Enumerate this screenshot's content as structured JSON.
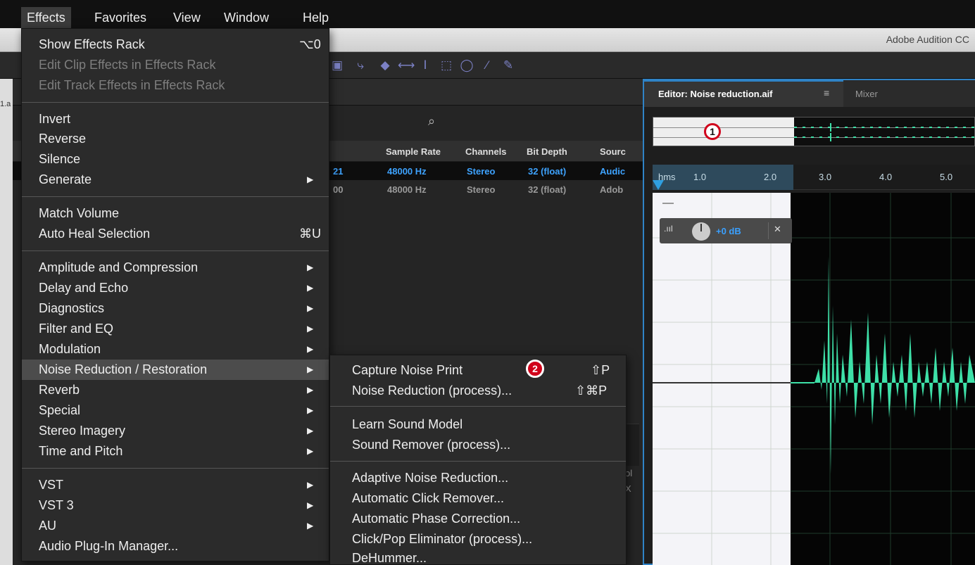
{
  "menubar": {
    "items": [
      {
        "label": "Effects"
      },
      {
        "label": "Favorites"
      },
      {
        "label": "View"
      },
      {
        "label": "Window"
      },
      {
        "label": "Help"
      }
    ]
  },
  "app": {
    "title": "Adobe Audition CC",
    "left_strip_text": "1.a"
  },
  "files_panel": {
    "columns": [
      "Sample Rate",
      "Channels",
      "Bit Depth",
      "Sourc"
    ],
    "rows": [
      {
        "prefix": "21",
        "sample_rate": "48000 Hz",
        "channels": "Stereo",
        "bit_depth": "32 (float)",
        "source": "Audic"
      },
      {
        "prefix": "00",
        "sample_rate": "48000 Hz",
        "channels": "Stereo",
        "bit_depth": "32 (float)",
        "source": "Adob"
      }
    ],
    "side_glyphs": [
      "ol",
      "X"
    ]
  },
  "editor": {
    "tab_label": "Editor: Noise reduction.aif",
    "tab_menu_icon": "≡",
    "mixer_label": "Mixer",
    "ruler": [
      "hms",
      "1.0",
      "2.0",
      "3.0",
      "4.0",
      "5.0"
    ],
    "hud_value": "+0 dB",
    "callout_1": "1",
    "waveform_color": "#3ee0a8"
  },
  "effects_menu": {
    "items": [
      {
        "label": "Show Effects Rack",
        "shortcut": "⌥0"
      },
      {
        "label": "Edit Clip Effects in Effects Rack",
        "disabled": true
      },
      {
        "label": "Edit Track Effects in Effects Rack",
        "disabled": true
      },
      {
        "label": "Invert"
      },
      {
        "label": "Reverse"
      },
      {
        "label": "Silence"
      },
      {
        "label": "Generate",
        "submenu": true
      },
      {
        "label": "Match Volume"
      },
      {
        "label": "Auto Heal Selection",
        "shortcut": "⌘U"
      },
      {
        "label": "Amplitude and Compression",
        "submenu": true
      },
      {
        "label": "Delay and Echo",
        "submenu": true
      },
      {
        "label": "Diagnostics",
        "submenu": true
      },
      {
        "label": "Filter and EQ",
        "submenu": true
      },
      {
        "label": "Modulation",
        "submenu": true
      },
      {
        "label": "Noise Reduction / Restoration",
        "submenu": true,
        "highlight": true
      },
      {
        "label": "Reverb",
        "submenu": true
      },
      {
        "label": "Special",
        "submenu": true
      },
      {
        "label": "Stereo Imagery",
        "submenu": true
      },
      {
        "label": "Time and Pitch",
        "submenu": true
      },
      {
        "label": "VST",
        "submenu": true
      },
      {
        "label": "VST 3",
        "submenu": true
      },
      {
        "label": "AU",
        "submenu": true
      },
      {
        "label": "Audio Plug-In Manager..."
      }
    ]
  },
  "noise_submenu": {
    "items": [
      {
        "label": "Capture Noise Print",
        "shortcut": "⇧P"
      },
      {
        "label": "Noise Reduction (process)...",
        "shortcut": "⇧⌘P"
      },
      {
        "label": "Learn Sound Model"
      },
      {
        "label": "Sound Remover (process)..."
      },
      {
        "label": "Adaptive Noise Reduction..."
      },
      {
        "label": "Automatic Click Remover..."
      },
      {
        "label": "Automatic Phase Correction..."
      },
      {
        "label": "Click/Pop Eliminator (process)..."
      },
      {
        "label": "DeHummer..."
      }
    ],
    "callout_2": "2"
  },
  "icons": {
    "submenu_arrow": "▶",
    "search": "⌕",
    "pin": "✕",
    "meter": ".ııl"
  },
  "colors": {
    "accent_blue": "#2f83c6",
    "callout_red": "#d0021b",
    "waveform": "#3ee0a8"
  }
}
